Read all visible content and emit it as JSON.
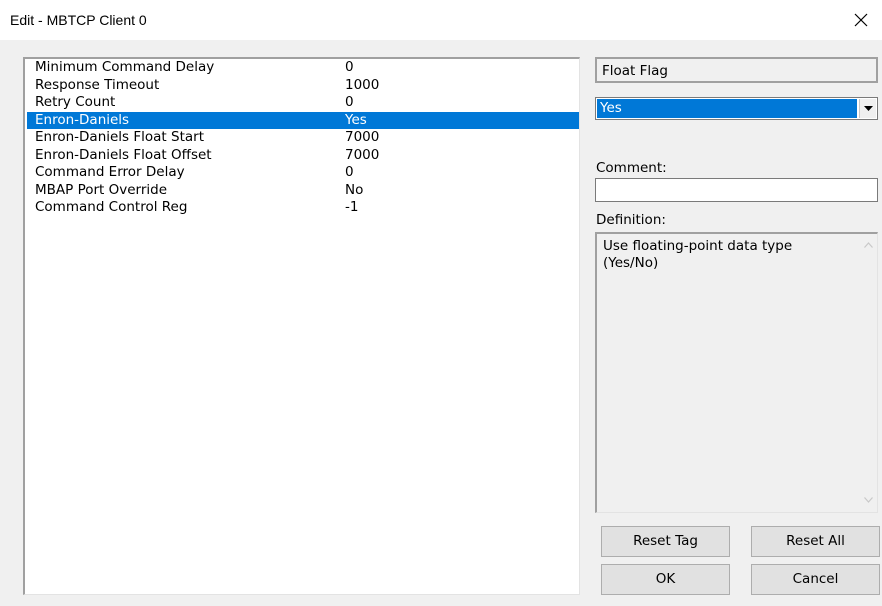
{
  "window": {
    "title": "Edit - MBTCP Client 0",
    "close_icon": "close-icon"
  },
  "parameters": [
    {
      "name": "Minimum Command Delay",
      "value": "0",
      "selected": false
    },
    {
      "name": "Response Timeout",
      "value": "1000",
      "selected": false
    },
    {
      "name": "Retry Count",
      "value": "0",
      "selected": false
    },
    {
      "name": "Enron-Daniels",
      "value": "Yes",
      "selected": true
    },
    {
      "name": "Enron-Daniels Float Start",
      "value": "7000",
      "selected": false
    },
    {
      "name": "Enron-Daniels Float Offset",
      "value": "7000",
      "selected": false
    },
    {
      "name": "Command Error Delay",
      "value": "0",
      "selected": false
    },
    {
      "name": "MBAP Port Override",
      "value": "No",
      "selected": false
    },
    {
      "name": "Command Control Reg",
      "value": "-1",
      "selected": false
    }
  ],
  "editor": {
    "field_label": "Float Flag",
    "selected_value": "Yes",
    "comment_label": "Comment:",
    "comment_value": "",
    "definition_label": "Definition:",
    "definition_text": "Use floating-point data type (Yes/No)"
  },
  "buttons": {
    "reset_tag": "Reset Tag",
    "reset_all": "Reset All",
    "ok": "OK",
    "cancel": "Cancel"
  },
  "colors": {
    "selection": "#0078d7",
    "dialog_bg": "#f0f0f0"
  }
}
